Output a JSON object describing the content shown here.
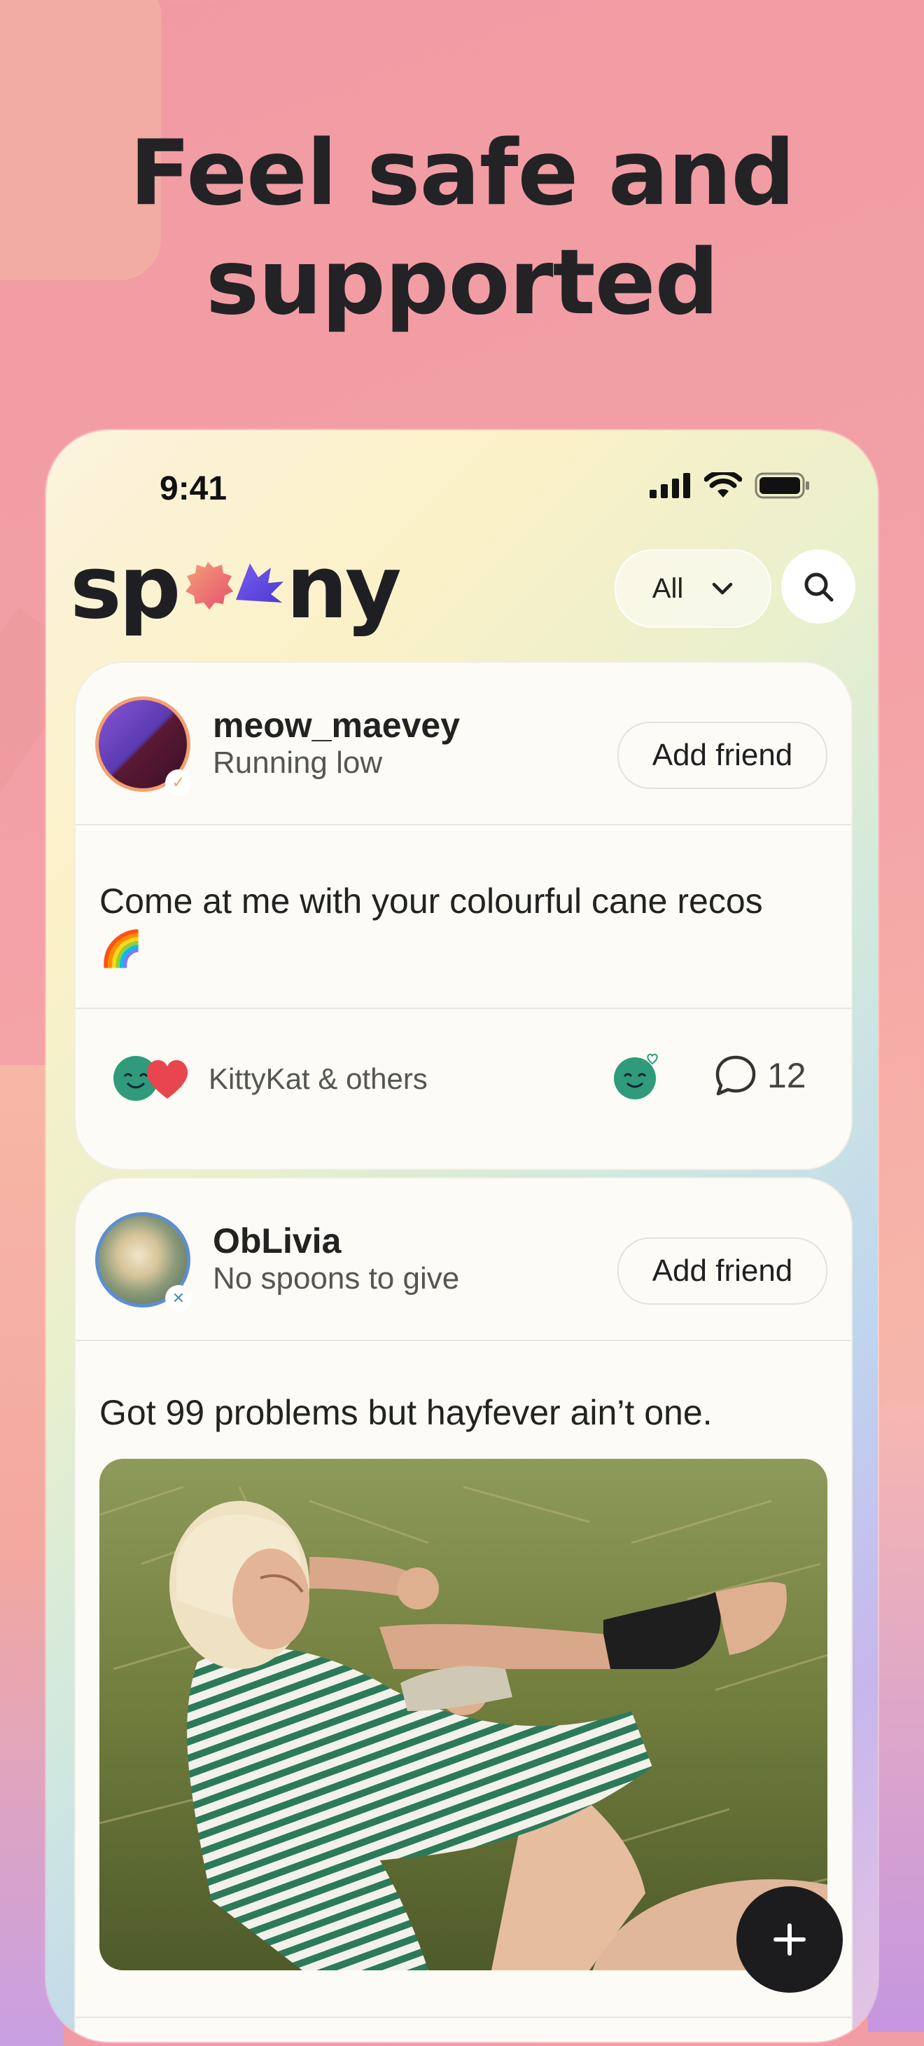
{
  "headline": {
    "line1": "Feel safe and",
    "line2": "supported"
  },
  "status_bar": {
    "time": "9:41"
  },
  "header": {
    "logo_text_left": "sp",
    "logo_text_right": "ny",
    "filter_label": "All"
  },
  "posts": [
    {
      "username": "meow_maevey",
      "status": "Running low",
      "add_friend_label": "Add friend",
      "text": "Come at me with your colourful cane recos 🌈",
      "reactions_label": "KittyKat & others",
      "comment_count": "12"
    },
    {
      "username": "ObLivia",
      "status": "No spoons to give",
      "add_friend_label": "Add friend",
      "text": "Got 99 problems but hayfever ain’t one."
    }
  ],
  "fab": {
    "icon": "plus-icon"
  },
  "colors": {
    "background": "#f19aa3",
    "card": "#fcfbf5",
    "text": "#1f1f23",
    "fab": "#1c1c1e",
    "accent_green": "#2f9b7a",
    "accent_red": "#e8454f"
  }
}
